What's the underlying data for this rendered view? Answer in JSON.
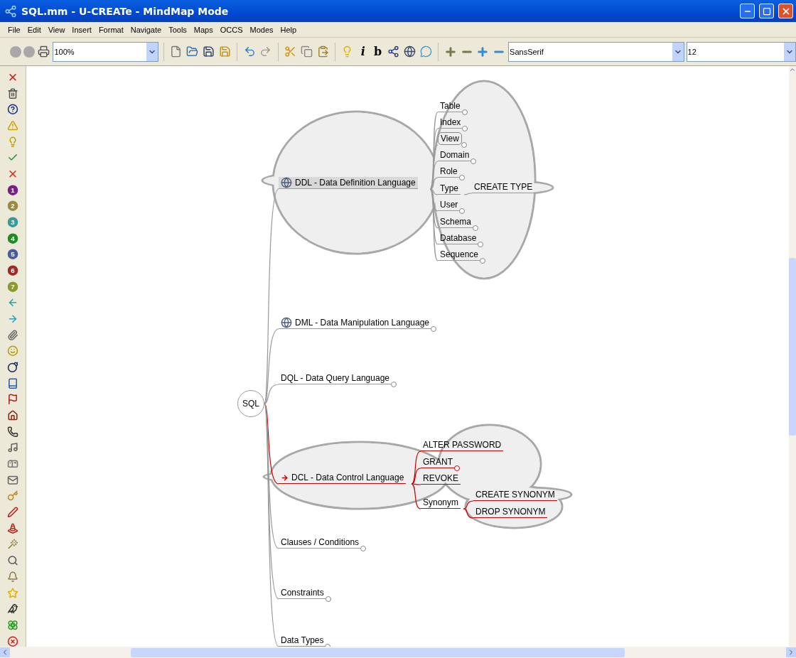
{
  "window": {
    "title": "SQL.mm - U-CREATe - MindMap Mode"
  },
  "menu": [
    "File",
    "Edit",
    "View",
    "Insert",
    "Format",
    "Navigate",
    "Tools",
    "Maps",
    "OCCS",
    "Modes",
    "Help"
  ],
  "toolbar": {
    "zoom": "100%",
    "italic": "i",
    "bold": "b",
    "font": "SansSerif",
    "font_size": "12"
  },
  "priority_icons": [
    {
      "label": "1",
      "color": "#7a1f8a"
    },
    {
      "label": "2",
      "color": "#9a8a40"
    },
    {
      "label": "3",
      "color": "#3a9a9a"
    },
    {
      "label": "4",
      "color": "#1f8a2a"
    },
    {
      "label": "5",
      "color": "#4a5a9a"
    },
    {
      "label": "6",
      "color": "#a02a2a"
    },
    {
      "label": "7",
      "color": "#8a9a30"
    }
  ],
  "map": {
    "root": {
      "text": "SQL",
      "selected": false,
      "children": [
        {
          "text": "DDL - Data Definition Language",
          "kind": "globe",
          "selected": true,
          "folded": false,
          "cloud": true,
          "highlighted": false,
          "bubble": false,
          "children": [
            {
              "text": "Table",
              "selected": false,
              "folded": true,
              "cloud": false,
              "highlighted": false,
              "bubble": false
            },
            {
              "text": "Index",
              "selected": false,
              "folded": true,
              "cloud": false,
              "highlighted": false,
              "bubble": false
            },
            {
              "text": "View",
              "selected": false,
              "folded": true,
              "cloud": false,
              "highlighted": false,
              "bubble": true
            },
            {
              "text": "Domain",
              "selected": false,
              "folded": true,
              "cloud": false,
              "highlighted": false,
              "bubble": false
            },
            {
              "text": "Role",
              "selected": false,
              "folded": true,
              "cloud": false,
              "highlighted": false,
              "bubble": false
            },
            {
              "text": "Type",
              "selected": false,
              "folded": false,
              "cloud": false,
              "highlighted": false,
              "bubble": false,
              "children": [
                {
                  "text": "CREATE TYPE",
                  "selected": false,
                  "folded": false,
                  "cloud": false,
                  "highlighted": false,
                  "bubble": false
                }
              ]
            },
            {
              "text": "User",
              "selected": false,
              "folded": true,
              "cloud": false,
              "highlighted": false,
              "bubble": false
            },
            {
              "text": "Schema",
              "selected": false,
              "folded": true,
              "cloud": false,
              "highlighted": false,
              "bubble": false
            },
            {
              "text": "Database",
              "selected": false,
              "folded": true,
              "cloud": false,
              "highlighted": false,
              "bubble": false
            },
            {
              "text": "Sequence",
              "selected": false,
              "folded": true,
              "cloud": false,
              "highlighted": false,
              "bubble": false
            }
          ]
        },
        {
          "text": "DML - Data Manipulation Language",
          "kind": "globe",
          "selected": false,
          "folded": true,
          "cloud": false,
          "highlighted": false,
          "bubble": false
        },
        {
          "text": "DQL - Data Query Language",
          "selected": false,
          "folded": true,
          "cloud": false,
          "highlighted": false,
          "bubble": false
        },
        {
          "text": "DCL - Data Control Language",
          "kind": "arrow",
          "selected": false,
          "folded": false,
          "cloud": true,
          "highlighted": true,
          "bubble": false,
          "children": [
            {
              "text": "ALTER PASSWORD",
              "selected": false,
              "folded": false,
              "cloud": false,
              "highlighted": true,
              "bubble": false
            },
            {
              "text": "GRANT",
              "selected": false,
              "folded": true,
              "cloud": false,
              "highlighted": true,
              "bubble": false
            },
            {
              "text": "REVOKE",
              "selected": false,
              "folded": false,
              "cloud": false,
              "highlighted": true,
              "bubble": false
            },
            {
              "text": "Synonym",
              "selected": false,
              "folded": false,
              "cloud": false,
              "highlighted": true,
              "bubble": false,
              "children": [
                {
                  "text": "CREATE SYNONYM",
                  "selected": false,
                  "folded": false,
                  "cloud": false,
                  "highlighted": true,
                  "bubble": false
                },
                {
                  "text": "DROP SYNONYM",
                  "selected": false,
                  "folded": false,
                  "cloud": false,
                  "highlighted": true,
                  "bubble": false
                }
              ]
            }
          ]
        },
        {
          "text": "Clauses / Conditions",
          "selected": false,
          "folded": true,
          "cloud": false,
          "highlighted": false,
          "bubble": false
        },
        {
          "text": "Constraints",
          "selected": false,
          "folded": true,
          "cloud": false,
          "highlighted": false,
          "bubble": false
        },
        {
          "text": "Data Types",
          "selected": false,
          "folded": true,
          "cloud": false,
          "highlighted": false,
          "bubble": false
        }
      ]
    }
  }
}
